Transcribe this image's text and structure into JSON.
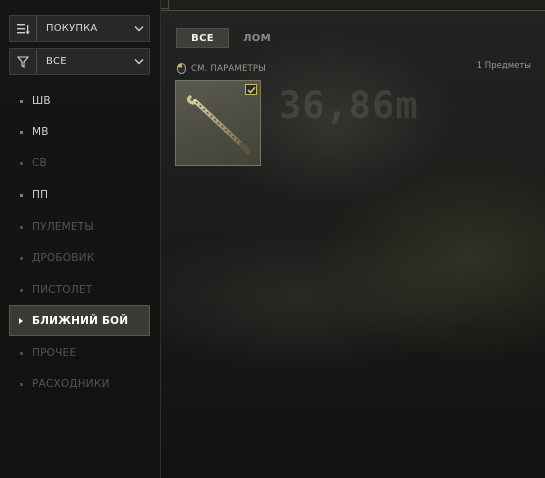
{
  "sidebar": {
    "dropdowns": [
      {
        "label": "ПОКУПКА",
        "icon": "sort-lines-icon"
      },
      {
        "label": "ВСЕ",
        "icon": "filter-funnel-icon"
      }
    ],
    "categories": [
      {
        "label": "ШВ",
        "state": "enabled"
      },
      {
        "label": "МВ",
        "state": "enabled"
      },
      {
        "label": "СВ",
        "state": "disabled"
      },
      {
        "label": "ПП",
        "state": "enabled"
      },
      {
        "label": "ПУЛЕМЕТЫ",
        "state": "disabled"
      },
      {
        "label": "ДРОБОВИК",
        "state": "disabled"
      },
      {
        "label": "ПИСТОЛЕТ",
        "state": "disabled"
      },
      {
        "label": "БЛИЖНИЙ БОЙ",
        "state": "active"
      },
      {
        "label": "ПРОЧЕЕ",
        "state": "disabled"
      },
      {
        "label": "РАСХОДНИКИ",
        "state": "disabled"
      }
    ]
  },
  "main": {
    "tabs": [
      {
        "label": "ВСЕ",
        "active": true
      },
      {
        "label": "ЛОМ",
        "active": false
      }
    ],
    "params_label": "СМ. ПАРАМЕТРЫ",
    "item_count": "1 Предметы",
    "items": [
      {
        "icon": "crowbar-weapon-icon",
        "selected": true
      }
    ]
  },
  "background": {
    "watermark_text": "36,86m"
  },
  "colors": {
    "accent_check": "#c9b760",
    "active_category_bg": "#3a3a37",
    "disabled_text": "#545450"
  }
}
